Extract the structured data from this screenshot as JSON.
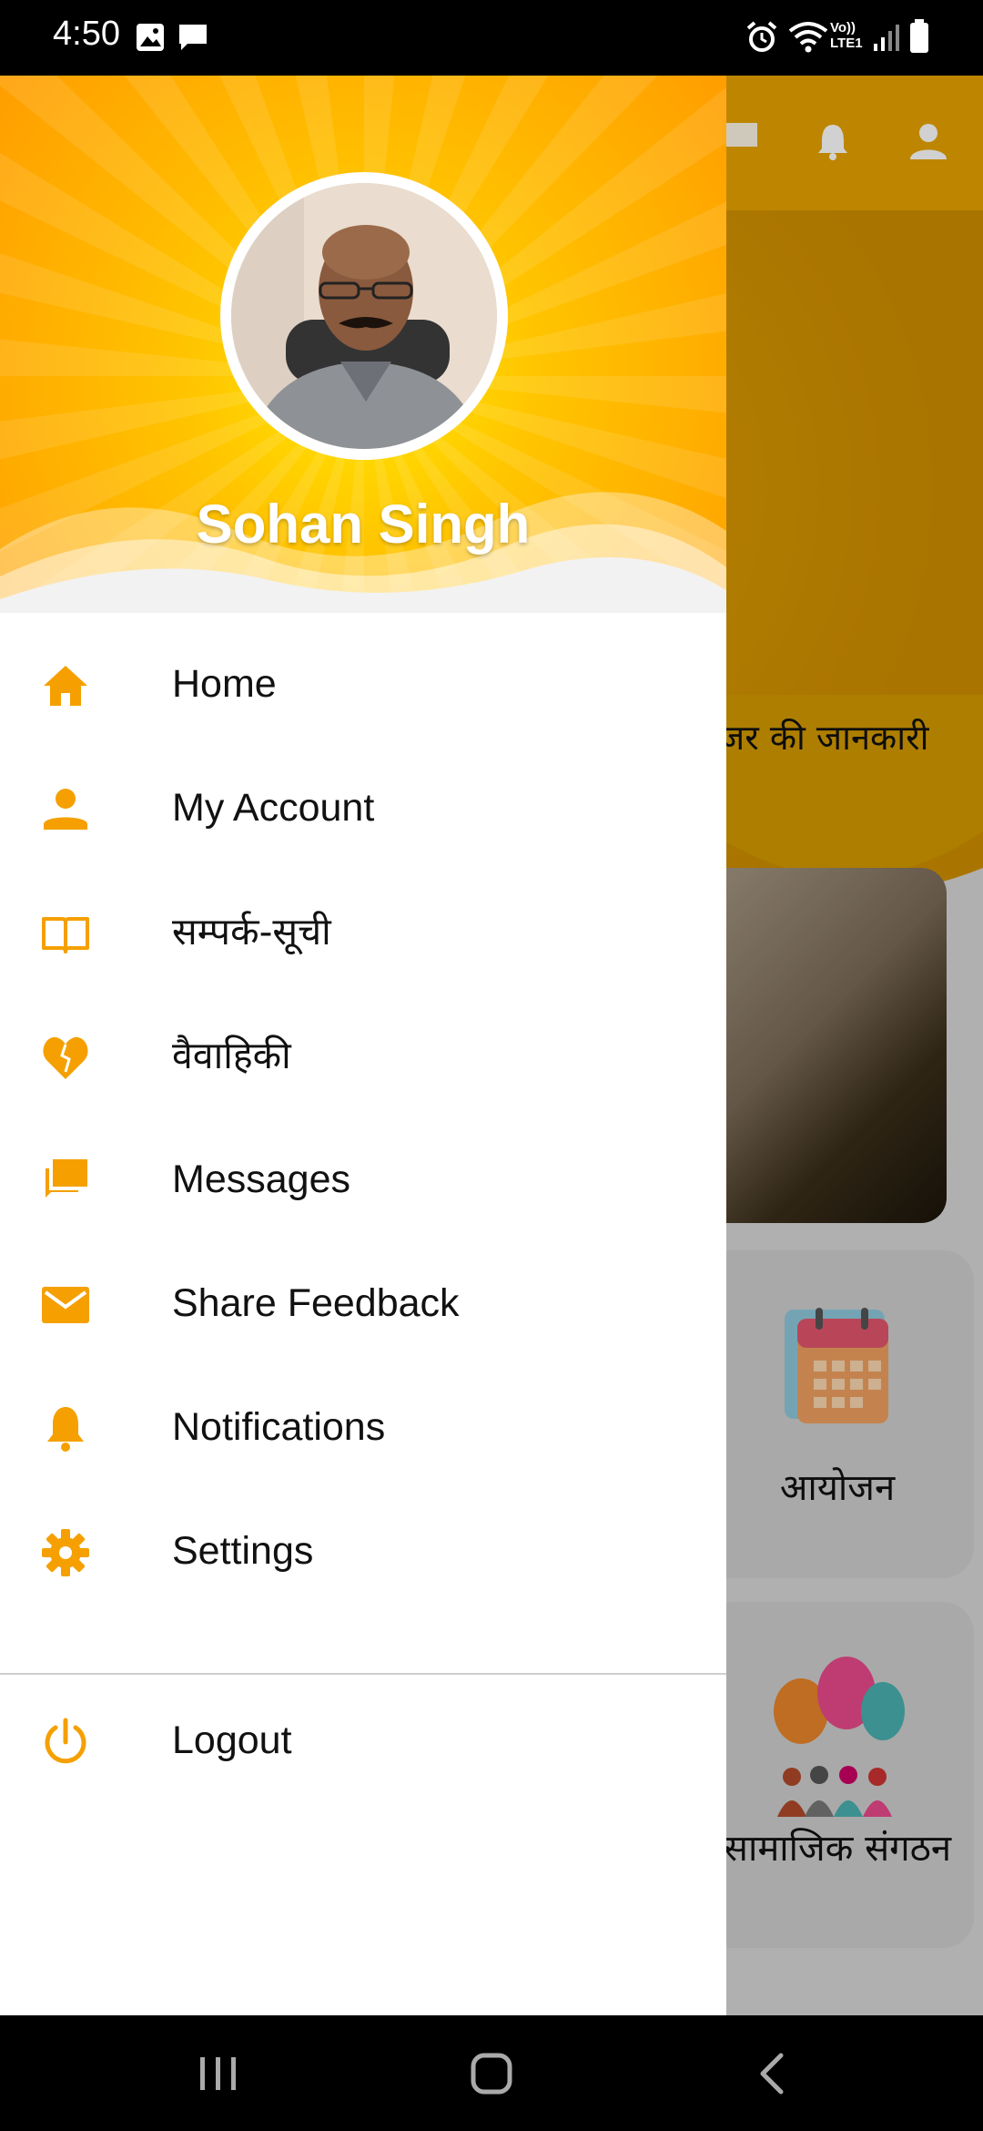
{
  "status_bar": {
    "time": "4:50",
    "network_label": "Vo)) LTE1"
  },
  "background_app": {
    "banner_text": "जर की जानकारी",
    "cards": [
      {
        "label": "आयोजन"
      },
      {
        "label": "सामाजिक संगठन"
      }
    ]
  },
  "drawer": {
    "user_name": "Sohan Singh",
    "menu": [
      {
        "label": "Home",
        "icon": "home-icon"
      },
      {
        "label": "My Account",
        "icon": "person-icon"
      },
      {
        "label": "सम्पर्क-सूची",
        "icon": "book-icon"
      },
      {
        "label": "वैवाहिकी",
        "icon": "heart-icon"
      },
      {
        "label": "Messages",
        "icon": "messages-icon"
      },
      {
        "label": "Share Feedback",
        "icon": "mail-icon"
      },
      {
        "label": "Notifications",
        "icon": "bell-icon"
      },
      {
        "label": "Settings",
        "icon": "gear-icon"
      },
      {
        "label": "Logout",
        "icon": "power-icon"
      }
    ]
  },
  "colors": {
    "accent": "#F5A000",
    "header_orange": "#FFA500",
    "header_yellow": "#FFD700"
  }
}
